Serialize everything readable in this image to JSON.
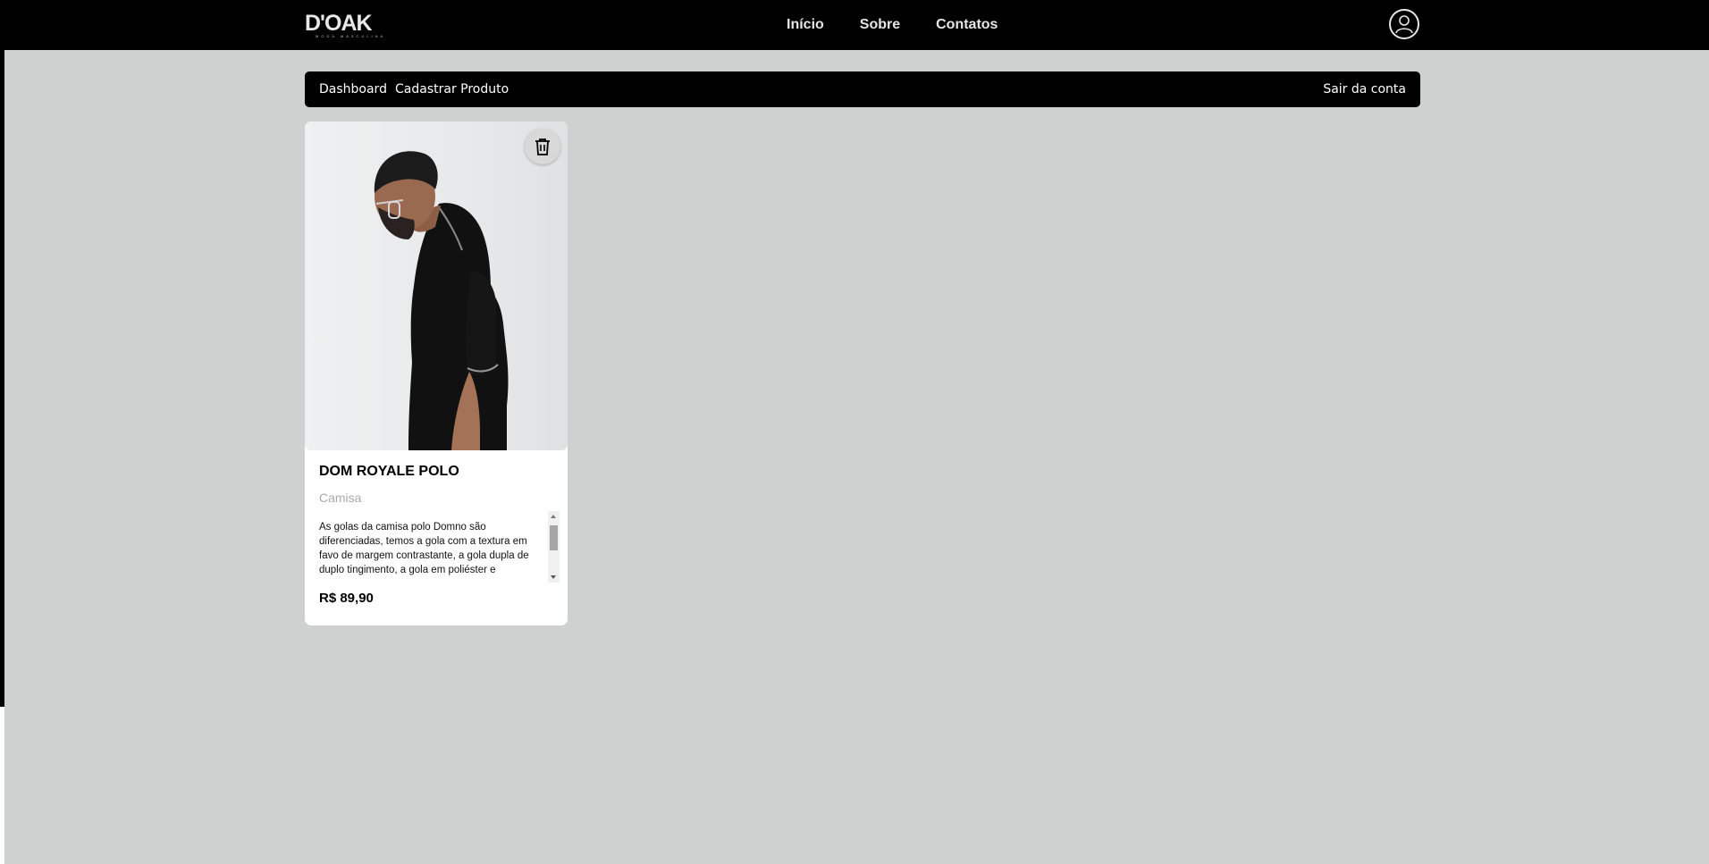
{
  "brand": {
    "logo_text": "D'OAK",
    "logo_tagline": "MODA MASCULINA"
  },
  "nav": {
    "items": [
      "Início",
      "Sobre",
      "Contatos"
    ]
  },
  "icons": {
    "user": "user-circle-icon",
    "delete": "trash-icon"
  },
  "subnav": {
    "dashboard": "Dashboard",
    "add_product": "Cadastrar Produto",
    "logout": "Sair da conta"
  },
  "products": [
    {
      "name": "DOM ROYALE POLO",
      "category": "Camisa",
      "description": "As golas da camisa polo Domno são diferenciadas, temos a gola com a textura em favo de margem contrastante, a gola dupla de duplo tingimento, a gola em poliéster e",
      "price": "R$ 89,90"
    }
  ],
  "colors": {
    "header": "#000000",
    "page_bg": "#cdd1d0",
    "card_bg": "#ffffff",
    "muted": "#aaaaaa"
  }
}
